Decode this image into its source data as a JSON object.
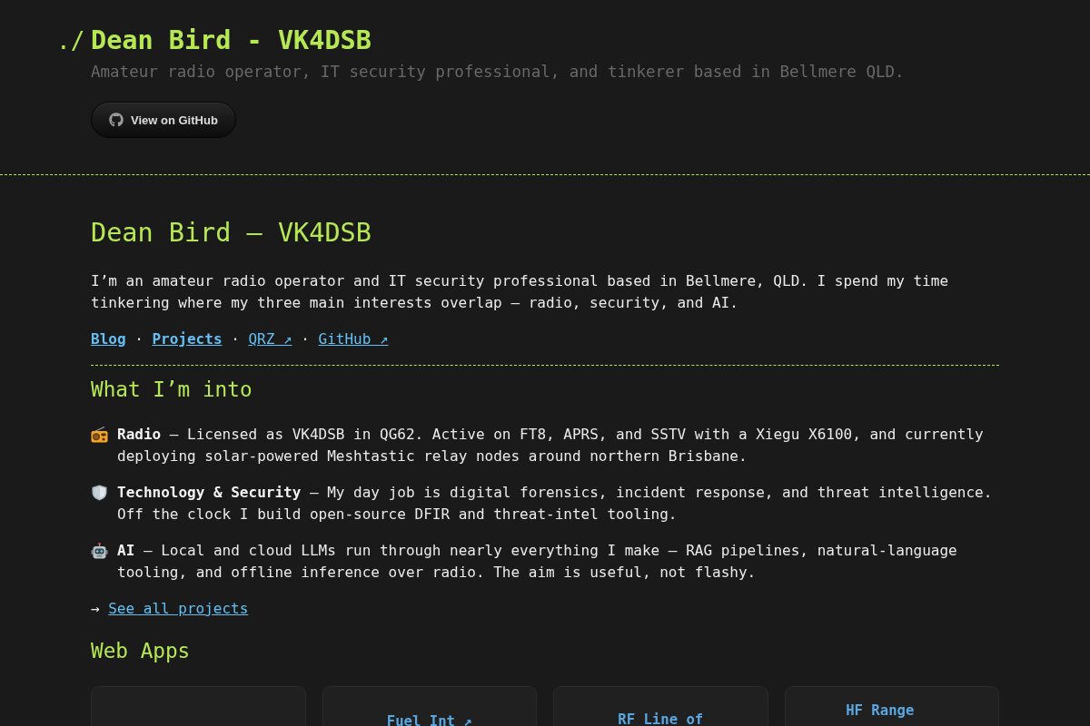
{
  "header": {
    "prompt": "./",
    "title": "Dean Bird - VK4DSB",
    "tagline": "Amateur radio operator, IT security professional, and tinkerer based in Bellmere QLD.",
    "button": "View on GitHub"
  },
  "intro": {
    "heading": "Dean Bird — VK4DSB",
    "text": "I’m an amateur radio operator and IT security professional based in Bellmere, QLD. I spend my time tinkering where my three main interests overlap — radio, security, and AI.",
    "links": [
      {
        "kind": "internal",
        "label": "Blog"
      },
      {
        "kind": "separator",
        "label": "·"
      },
      {
        "kind": "internal",
        "label": "Projects"
      },
      {
        "kind": "separator",
        "label": "·"
      },
      {
        "kind": "external",
        "label": "QRZ ↗"
      },
      {
        "kind": "separator",
        "label": "·"
      },
      {
        "kind": "external",
        "label": "GitHub ↗"
      }
    ]
  },
  "interests": {
    "heading": "What I’m into",
    "items": [
      {
        "text": "**Radio** — Licensed as VK4DSB in QG62. Active on FT8, APRS, and SSTV with a Xiegu X6100, and currently deploying solar-powered Meshtastic relay nodes around northern Brisbane."
      },
      {
        "text": "**Technology & Security** — My day job is digital forensics, incident response, and threat intelligence. Off the clock I build open-source DFIR and threat-intel tooling."
      },
      {
        "text": "**AI** — Local and cloud LLMs run through nearly everything I make — RAG pipelines, natural-language tooling, and offline inference over radio. The aim is useful, not flashy."
      }
    ],
    "more": {
      "arrow": "→",
      "link": "See all projects"
    }
  },
  "web_apps": {
    "heading": "Web Apps",
    "cards": [
      {
        "kind": "blank"
      },
      {
        "kind": "app",
        "title": "Fuel Int ↗"
      },
      {
        "kind": "app",
        "title": "RF Line of"
      },
      {
        "kind": "app",
        "title": "HF Range"
      }
    ]
  }
}
